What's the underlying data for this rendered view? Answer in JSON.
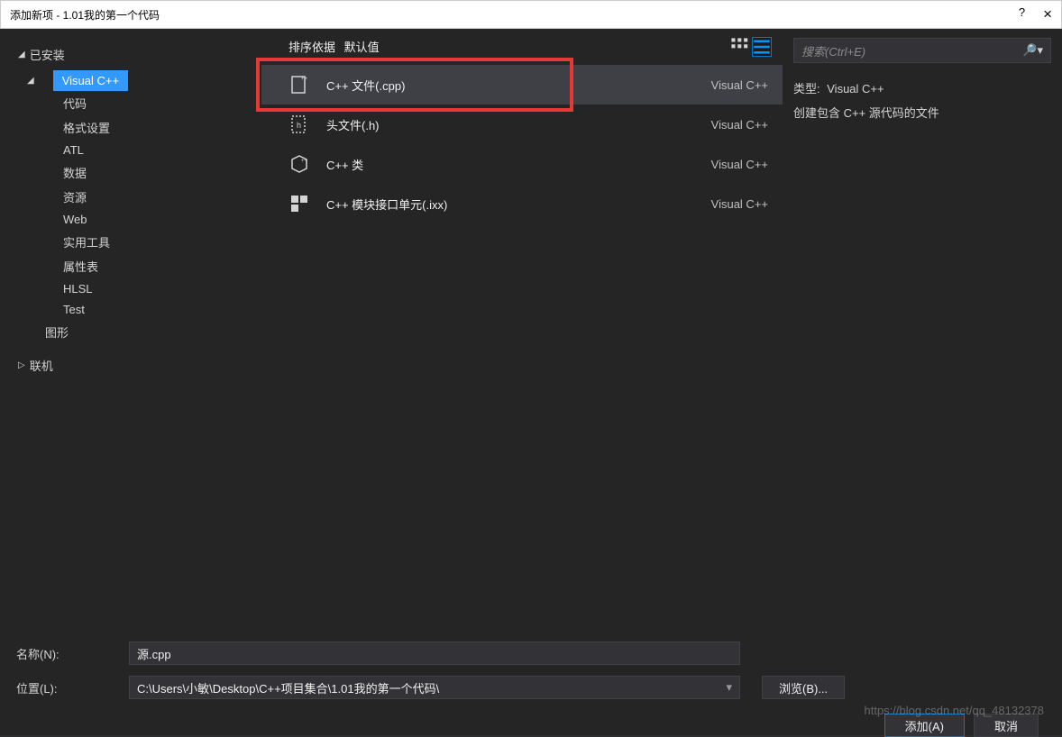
{
  "titlebar": {
    "title": "添加新项 - 1.01我的第一个代码",
    "help": "?",
    "close": "×"
  },
  "sidebar": {
    "installed": "已安装",
    "selected": "Visual C++",
    "children": [
      "代码",
      "格式设置",
      "ATL",
      "数据",
      "资源",
      "Web",
      "实用工具",
      "属性表",
      "HLSL",
      "Test"
    ],
    "graphics": "图形",
    "online": "联机"
  },
  "topbar": {
    "sort_fragment_left": "排序依据",
    "sort_fragment_right": "默认值"
  },
  "templates": [
    {
      "name": "C++ 文件(.cpp)",
      "lang": "Visual C++",
      "selected": true,
      "icon": "cpp-file"
    },
    {
      "name": "头文件(.h)",
      "lang": "Visual C++",
      "selected": false,
      "icon": "h-file"
    },
    {
      "name": "C++ 类",
      "lang": "Visual C++",
      "selected": false,
      "icon": "cpp-class"
    },
    {
      "name": "C++ 模块接口单元(.ixx)",
      "lang": "Visual C++",
      "selected": false,
      "icon": "module"
    }
  ],
  "rightpanel": {
    "search_placeholder": "搜索(Ctrl+E)",
    "type_label": "类型:",
    "type_value": "Visual C++",
    "description": "创建包含 C++ 源代码的文件"
  },
  "bottom": {
    "name_label": "名称(N):",
    "name_value": "源.cpp",
    "location_label": "位置(L):",
    "location_value": "C:\\Users\\小敏\\Desktop\\C++项目集合\\1.01我的第一个代码\\",
    "browse": "浏览(B)...",
    "add": "添加(A)",
    "cancel": "取消"
  },
  "watermark": "https://blog.csdn.net/qq_48132378"
}
